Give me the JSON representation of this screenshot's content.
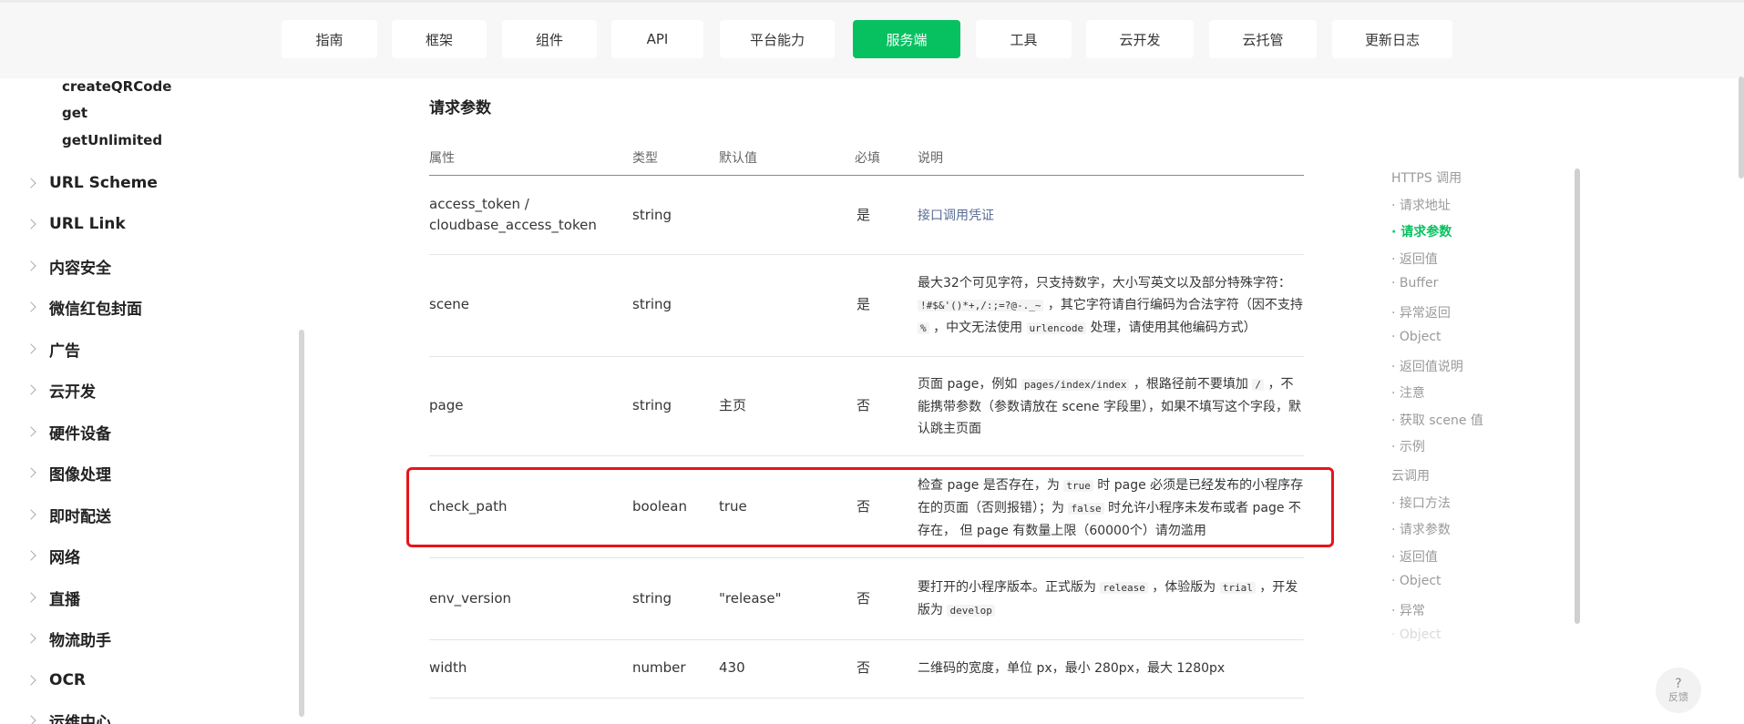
{
  "nav": {
    "items": [
      "指南",
      "框架",
      "组件",
      "API",
      "平台能力",
      "服务端",
      "工具",
      "云开发",
      "云托管",
      "更新日志"
    ],
    "active": "服务端",
    "accent_color": "#07c160"
  },
  "sidebar": {
    "sub_items": [
      "createQRCode",
      "get",
      "getUnlimited"
    ],
    "categories": [
      "URL Scheme",
      "URL Link",
      "内容安全",
      "微信红包封面",
      "广告",
      "云开发",
      "硬件设备",
      "图像处理",
      "即时配送",
      "网络",
      "直播",
      "物流助手",
      "OCR",
      "运维中心"
    ],
    "chevron_icon": "chevron-right-icon"
  },
  "main": {
    "section_title": "请求参数",
    "headers": [
      "属性",
      "类型",
      "默认值",
      "必填",
      "说明"
    ],
    "rows": [
      {
        "name_line1": "access_token /",
        "name_line2": "cloudbase_access_token",
        "type": "string",
        "default": "",
        "required": "是",
        "desc_link": "接口调用凭证"
      },
      {
        "name": "scene",
        "type": "string",
        "default": "",
        "required": "是",
        "desc": {
          "t1": "最大32个可见字符，只支持数字，大小写英文以及部分特殊字符：",
          "c1": "!#$&'()*+,/:;=?@-._~",
          "t2": "，其它字符请自行编码为合法字符（因不支持",
          "c2": "%",
          "t3": "，中文无法使用",
          "c3": "urlencode",
          "t4": "处理，请使用其他编码方式）"
        }
      },
      {
        "name": "page",
        "type": "string",
        "default": "主页",
        "required": "否",
        "desc": {
          "t1": "页面 page，例如",
          "c1": "pages/index/index",
          "t2": "，根路径前不要填加",
          "c2": "/",
          "t3": "，不能携带参数（参数请放在 scene 字段里），如果不填写这个字段，默认跳主页面"
        }
      },
      {
        "name": "check_path",
        "type": "boolean",
        "default": "true",
        "required": "否",
        "desc": {
          "t1": "检查 page 是否存在，为",
          "c1": "true",
          "t2": "时 page 必须是已经发布的小程序存在的页面（否则报错）；为",
          "c2": "false",
          "t3": "时允许小程序未发布或者 page 不存在， 但 page 有数量上限（60000个）请勿滥用"
        }
      },
      {
        "name": "env_version",
        "type": "string",
        "default": "\"release\"",
        "required": "否",
        "desc": {
          "t1": "要打开的小程序版本。正式版为",
          "c1": "release",
          "t2": "，体验版为",
          "c2": "trial",
          "t3": "，开发版为",
          "c3": "develop"
        }
      },
      {
        "name": "width",
        "type": "number",
        "default": "430",
        "required": "否",
        "desc": "二维码的宽度，单位 px，最小 280px，最大 1280px"
      }
    ],
    "highlight_color": "#e8141c"
  },
  "toc": {
    "items": [
      {
        "label": "HTTPS 调用",
        "level": 0
      },
      {
        "label": "请求地址",
        "level": 1
      },
      {
        "label": "请求参数",
        "level": 1,
        "active": true
      },
      {
        "label": "返回值",
        "level": 1
      },
      {
        "label": "Buffer",
        "level": 1
      },
      {
        "label": "异常返回",
        "level": 1
      },
      {
        "label": "Object",
        "level": 1
      },
      {
        "label": "返回值说明",
        "level": 1
      },
      {
        "label": "注意",
        "level": 1
      },
      {
        "label": "获取 scene 值",
        "level": 1
      },
      {
        "label": "示例",
        "level": 1
      },
      {
        "label": "云调用",
        "level": 0
      },
      {
        "label": "接口方法",
        "level": 1
      },
      {
        "label": "请求参数",
        "level": 1
      },
      {
        "label": "返回值",
        "level": 1
      },
      {
        "label": "Object",
        "level": 1
      },
      {
        "label": "异常",
        "level": 1
      },
      {
        "label": "Object",
        "level": 1
      }
    ]
  },
  "feedback": {
    "icon": "question-icon",
    "label": "反馈",
    "symbol": "?"
  }
}
